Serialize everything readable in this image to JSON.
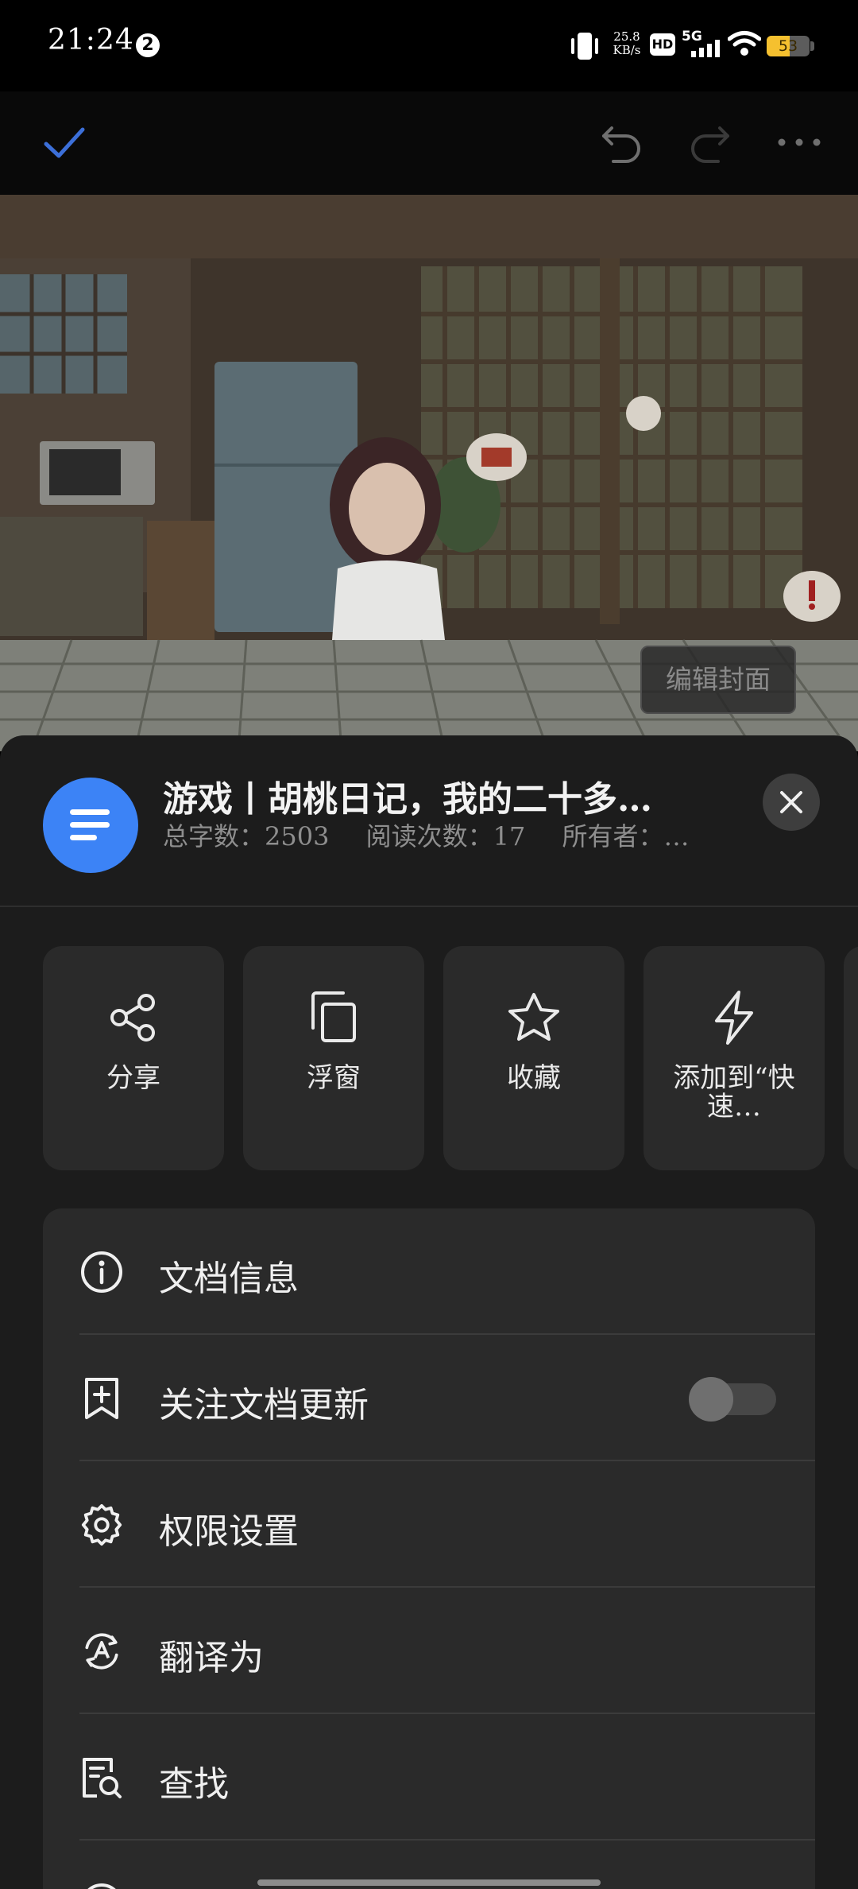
{
  "status_bar": {
    "time": "21:24",
    "notification_count": "2",
    "net_speed_value": "25.8",
    "net_speed_unit": "KB/s",
    "hd_label": "HD",
    "signal_label": "5G",
    "battery_level": "53",
    "battery_fraction": 0.53,
    "battery_color": "#f5c02f"
  },
  "toolbar": {
    "confirm_icon": "checkmark-icon",
    "undo_icon": "undo-icon",
    "redo_icon": "redo-icon",
    "more_icon": "more-icon",
    "accent_color": "#3c6fd8"
  },
  "cover": {
    "edit_label": "编辑封面"
  },
  "doc": {
    "title": "游戏丨胡桃日记，我的二十多…",
    "word_count": "总字数：2503",
    "read_count": "阅读次数：17",
    "owner": "所有者：…",
    "icon_color": "#3c83f6"
  },
  "actions": [
    {
      "icon": "share-icon",
      "label": "分享"
    },
    {
      "icon": "floating-window-icon",
      "label": "浮窗"
    },
    {
      "icon": "star-icon",
      "label": "收藏"
    },
    {
      "icon": "lightning-icon",
      "label": "添加到“快速…"
    }
  ],
  "menu": {
    "items": [
      {
        "icon": "info-icon",
        "label": "文档信息"
      },
      {
        "icon": "bookmark-plus-icon",
        "label": "关注文档更新",
        "toggle": false
      },
      {
        "icon": "gear-icon",
        "label": "权限设置"
      },
      {
        "icon": "translate-icon",
        "label": "翻译为"
      },
      {
        "icon": "find-in-document-icon",
        "label": "查找"
      }
    ]
  }
}
